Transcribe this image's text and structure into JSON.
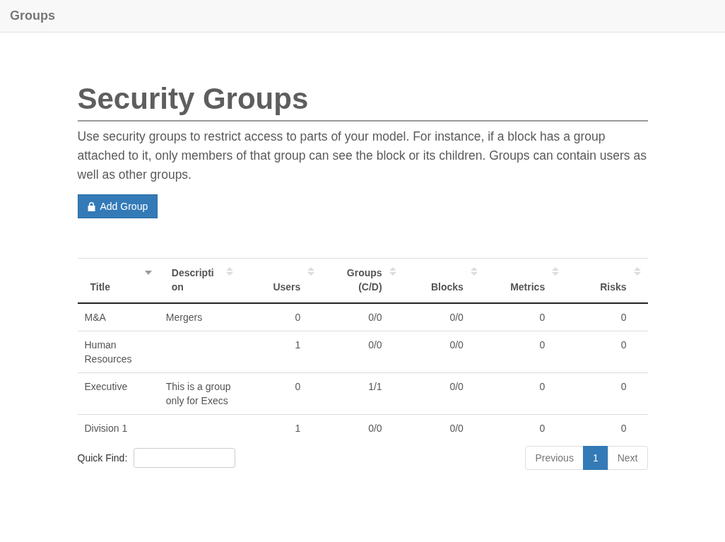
{
  "navbar": {
    "title": "Groups"
  },
  "heading": "Security Groups",
  "intro": "Use security groups to restrict access to parts of your model. For instance, if a block has a group attached to it, only members of that group can see the block or its children. Groups can contain users as well as other groups.",
  "add_button": {
    "label": "Add Group"
  },
  "table": {
    "columns": [
      {
        "label": "Title",
        "numeric": false,
        "sorted": true
      },
      {
        "label": "Description",
        "numeric": false,
        "sorted": false
      },
      {
        "label": "Users",
        "numeric": true,
        "sorted": false
      },
      {
        "label": "Groups (C/D)",
        "numeric": true,
        "sorted": false
      },
      {
        "label": "Blocks",
        "numeric": true,
        "sorted": false
      },
      {
        "label": "Metrics",
        "numeric": true,
        "sorted": false
      },
      {
        "label": "Risks",
        "numeric": true,
        "sorted": false
      }
    ],
    "rows": [
      [
        "M&A",
        "Mergers",
        "0",
        "0/0",
        "0/0",
        "0",
        "0"
      ],
      [
        "Human Resources",
        "",
        "1",
        "0/0",
        "0/0",
        "0",
        "0"
      ],
      [
        "Executive",
        "This is a group only for Execs",
        "0",
        "1/1",
        "0/0",
        "0",
        "0"
      ],
      [
        "Division 1",
        "",
        "1",
        "0/0",
        "0/0",
        "0",
        "0"
      ]
    ]
  },
  "quick_find": {
    "label": "Quick Find:"
  },
  "pagination": [
    {
      "label": "Previous",
      "selected": false
    },
    {
      "label": "1",
      "selected": true
    },
    {
      "label": "Next",
      "selected": false
    }
  ]
}
